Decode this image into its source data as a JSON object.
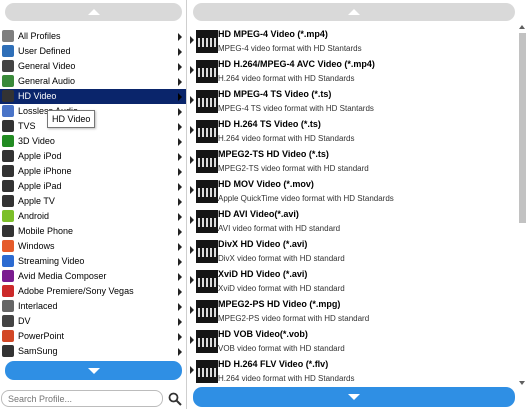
{
  "left_panel": {
    "profiles": [
      {
        "label": "All Profiles",
        "icon": "profile-folder-icon",
        "color": "#7f7f7f",
        "selected": false
      },
      {
        "label": "User Defined",
        "icon": "user-icon",
        "color": "#2f6fb8",
        "selected": false
      },
      {
        "label": "General Video",
        "icon": "film-icon",
        "color": "#444444",
        "selected": false
      },
      {
        "label": "General Audio",
        "icon": "music-note-icon",
        "color": "#3a8a3a",
        "selected": false
      },
      {
        "label": "HD Video",
        "icon": "hd-icon",
        "color": "#333333",
        "selected": true
      },
      {
        "label": "Lossless Audio",
        "icon": "music-note-icon",
        "color": "#4a74c8",
        "selected": false
      },
      {
        "label": "TVS",
        "icon": "tv-icon",
        "color": "#333333",
        "selected": false
      },
      {
        "label": "3D Video",
        "icon": "3d-icon",
        "color": "#228b22",
        "selected": false
      },
      {
        "label": "Apple iPod",
        "icon": "ipod-icon",
        "color": "#333333",
        "selected": false
      },
      {
        "label": "Apple iPhone",
        "icon": "iphone-icon",
        "color": "#333333",
        "selected": false
      },
      {
        "label": "Apple iPad",
        "icon": "ipad-icon",
        "color": "#333333",
        "selected": false
      },
      {
        "label": "Apple TV",
        "icon": "apple-tv-icon",
        "color": "#333333",
        "selected": false
      },
      {
        "label": "Android",
        "icon": "android-icon",
        "color": "#7cbf29",
        "selected": false
      },
      {
        "label": "Mobile Phone",
        "icon": "mobile-phone-icon",
        "color": "#333333",
        "selected": false
      },
      {
        "label": "Windows",
        "icon": "windows-icon",
        "color": "#e55b2b",
        "selected": false
      },
      {
        "label": "Streaming Video",
        "icon": "streaming-icon",
        "color": "#2c6bd1",
        "selected": false
      },
      {
        "label": "Avid Media Composer",
        "icon": "avid-icon",
        "color": "#7a1c8f",
        "selected": false
      },
      {
        "label": "Adobe Premiere/Sony Vegas",
        "icon": "adobe-icon",
        "color": "#cc2a2a",
        "selected": false
      },
      {
        "label": "Interlaced",
        "icon": "interlaced-icon",
        "color": "#666666",
        "selected": false
      },
      {
        "label": "DV",
        "icon": "dv-icon",
        "color": "#444444",
        "selected": false
      },
      {
        "label": "PowerPoint",
        "icon": "powerpoint-icon",
        "color": "#d24726",
        "selected": false
      },
      {
        "label": "SamSung",
        "icon": "samsung-icon",
        "color": "#333333",
        "selected": false
      }
    ],
    "tooltip": "HD Video",
    "search_placeholder": "Search Profile..."
  },
  "right_panel": {
    "formats": [
      {
        "title": "HD MPEG-4 Video (*.mp4)",
        "desc": "MPEG-4 video format with HD Stantards"
      },
      {
        "title": "HD H.264/MPEG-4 AVC Video (*.mp4)",
        "desc": "H.264 video format with HD Standards"
      },
      {
        "title": "HD MPEG-4 TS Video (*.ts)",
        "desc": "MPEG-4 TS video format with HD Stantards"
      },
      {
        "title": "HD H.264 TS Video (*.ts)",
        "desc": "H.264 video format with HD Standards"
      },
      {
        "title": "MPEG2-TS HD Video (*.ts)",
        "desc": "MPEG2-TS video format with HD standard"
      },
      {
        "title": "HD MOV Video (*.mov)",
        "desc": "Apple QuickTime video format with HD Standards"
      },
      {
        "title": "HD AVI Video(*.avi)",
        "desc": "AVI video format with HD standard"
      },
      {
        "title": "DivX HD Video (*.avi)",
        "desc": "DivX video format with HD standard"
      },
      {
        "title": "XviD HD Video (*.avi)",
        "desc": "XviD video format with HD standard"
      },
      {
        "title": "MPEG2-PS HD Video (*.mpg)",
        "desc": "MPEG2-PS video format with HD standard"
      },
      {
        "title": "HD VOB Video(*.vob)",
        "desc": "VOB video format with HD standard"
      },
      {
        "title": "HD H.264 FLV Video (*.flv)",
        "desc": "H.264 video format with HD Standards"
      }
    ]
  },
  "colors": {
    "accent": "#2f8fe4",
    "selection": "#0a256b",
    "scroll_inactive": "#d9d9d9"
  }
}
